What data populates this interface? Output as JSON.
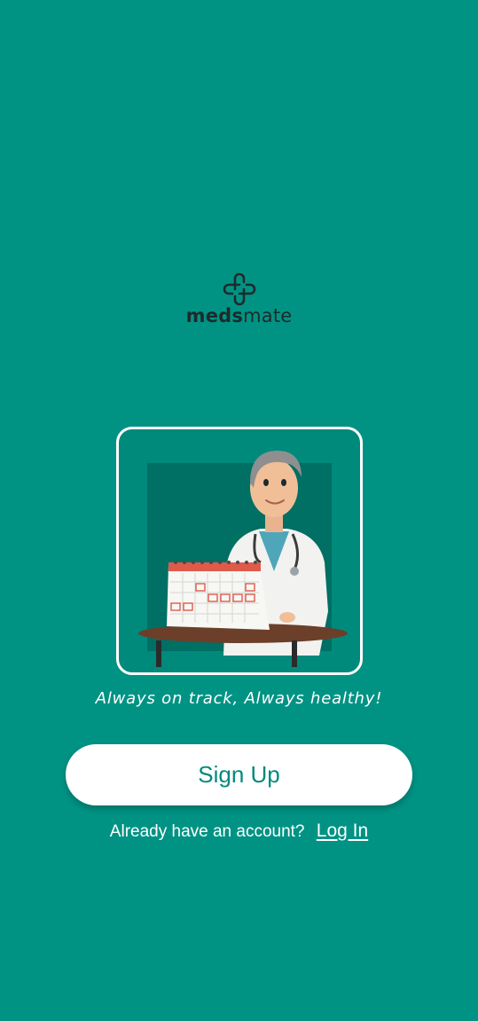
{
  "brand": {
    "name_bold": "meds",
    "name_light": "mate"
  },
  "illustration": {
    "icon": "doctor-with-calendar-illustration"
  },
  "tagline": "Always on track, Always healthy!",
  "signup": {
    "label": "Sign Up"
  },
  "login": {
    "prompt": "Already have an account?",
    "link_label": "Log In"
  },
  "colors": {
    "background": "#009384",
    "accent_text": "#00897b",
    "button_bg": "#ffffff"
  }
}
